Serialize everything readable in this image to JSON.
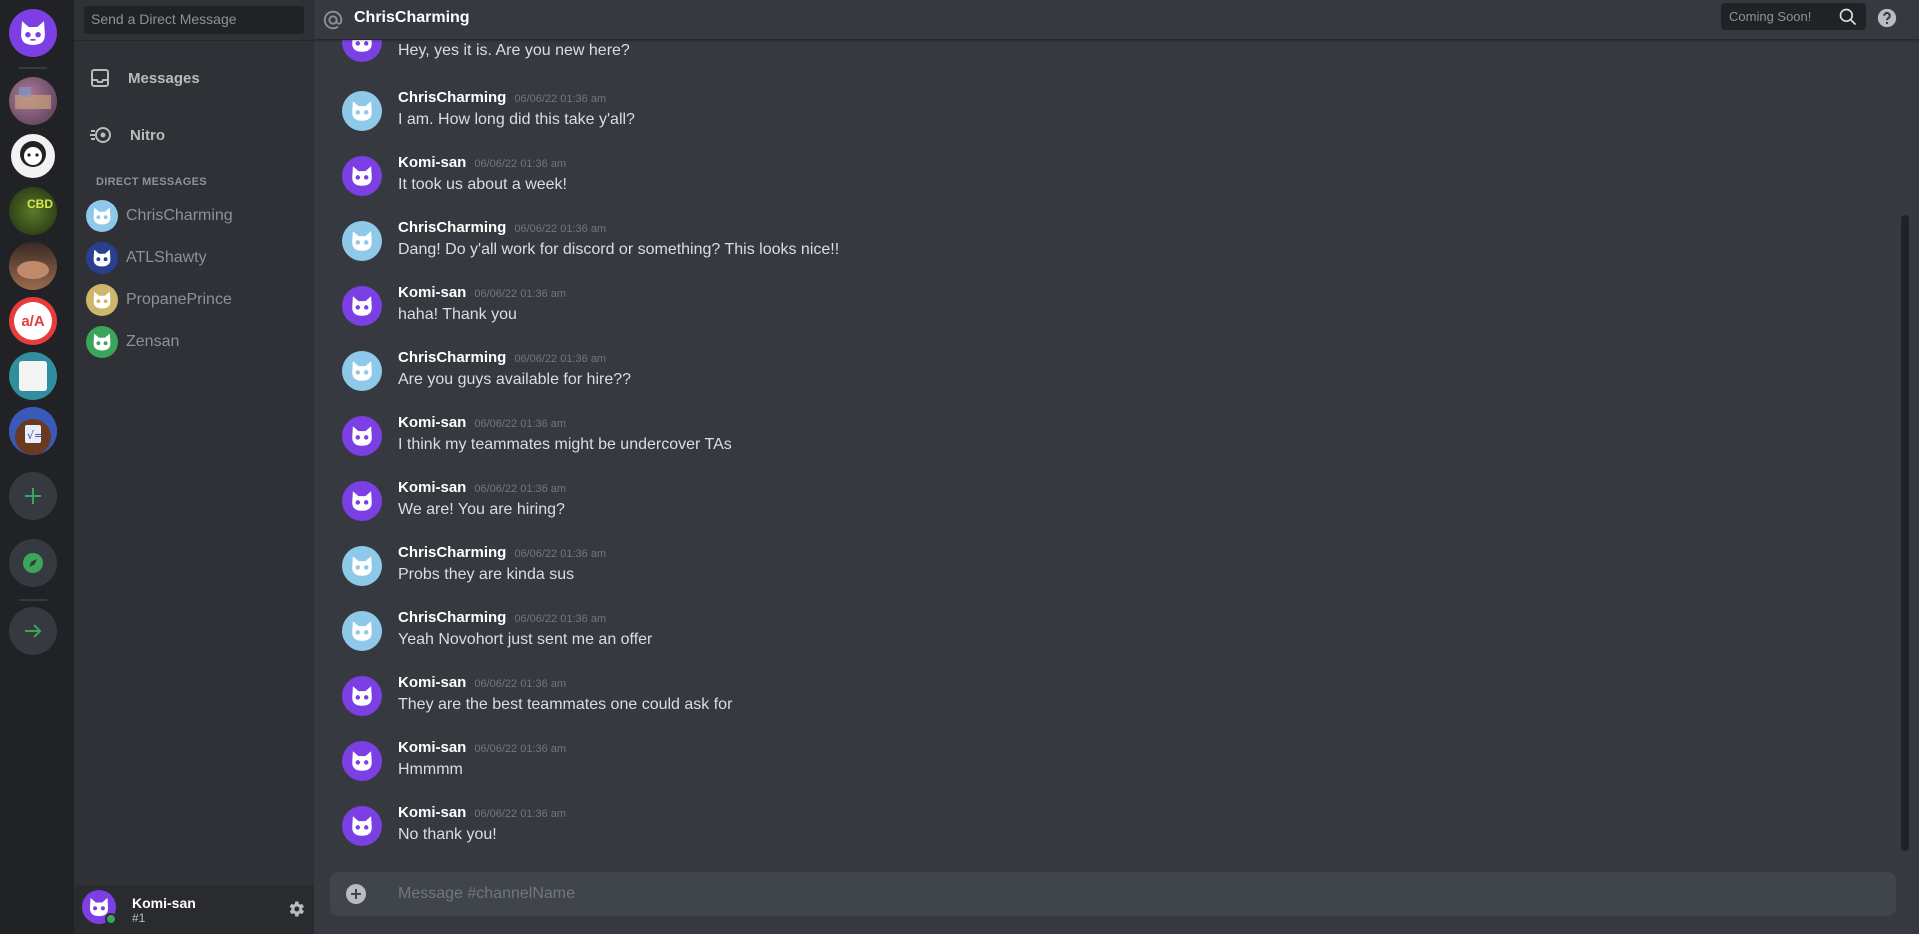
{
  "servers": [
    {
      "name": "home",
      "color": "#7b3fe4",
      "icon": "cat-logo-icon"
    },
    {
      "name": "server-1",
      "color": "#6b5b6e",
      "icon": "server-image-1"
    },
    {
      "name": "server-2",
      "color": "#eeeeee",
      "icon": "server-image-2"
    },
    {
      "name": "server-3",
      "color": "#3d5a1e",
      "icon": "server-image-3",
      "label": "CBD"
    },
    {
      "name": "server-4",
      "color": "#7a5a4a",
      "icon": "server-image-4"
    },
    {
      "name": "server-5",
      "color": "#e83c3c",
      "icon": "server-image-5",
      "label": "a/A"
    },
    {
      "name": "server-6",
      "color": "#2f8f9f",
      "icon": "server-image-6"
    },
    {
      "name": "server-7",
      "color": "#2a4aa8",
      "icon": "server-image-7"
    }
  ],
  "sidebar": {
    "search_placeholder": "Send a Direct Message",
    "nav": [
      {
        "label": "Messages",
        "icon": "inbox-icon"
      },
      {
        "label": "Nitro",
        "icon": "nitro-icon"
      }
    ],
    "dm_header": "DIRECT MESSAGES",
    "dms": [
      {
        "name": "ChrisCharming",
        "color": "#8fc9ea"
      },
      {
        "name": "ATLShawty",
        "color": "#2a3f8f"
      },
      {
        "name": "PropanePrince",
        "color": "#cdb76a"
      },
      {
        "name": "Zensan",
        "color": "#3ba55c"
      }
    ]
  },
  "user": {
    "name": "Komi-san",
    "tag": "#1"
  },
  "header": {
    "channel": "ChrisCharming",
    "search_placeholder": "Coming Soon!"
  },
  "messages": [
    {
      "author": "",
      "time": "",
      "text": "Hey, yes it is. Are you new here?",
      "color": "#7b3fe4"
    },
    {
      "author": "ChrisCharming",
      "time": "06/06/22 01:36 am",
      "text": "I am. How long did this take y'all?",
      "color": "#8fc9ea"
    },
    {
      "author": "Komi-san",
      "time": "06/06/22 01:36 am",
      "text": "It took us about a week!",
      "color": "#7b3fe4"
    },
    {
      "author": "ChrisCharming",
      "time": "06/06/22 01:36 am",
      "text": "Dang! Do y'all work for discord or something? This looks nice!!",
      "color": "#8fc9ea"
    },
    {
      "author": "Komi-san",
      "time": "06/06/22 01:36 am",
      "text": "haha! Thank you",
      "color": "#7b3fe4"
    },
    {
      "author": "ChrisCharming",
      "time": "06/06/22 01:36 am",
      "text": "Are you guys available for hire??",
      "color": "#8fc9ea"
    },
    {
      "author": "Komi-san",
      "time": "06/06/22 01:36 am",
      "text": "I think my teammates might be undercover TAs",
      "color": "#7b3fe4"
    },
    {
      "author": "Komi-san",
      "time": "06/06/22 01:36 am",
      "text": "We are! You are hiring?",
      "color": "#7b3fe4"
    },
    {
      "author": "ChrisCharming",
      "time": "06/06/22 01:36 am",
      "text": "Probs they are kinda sus",
      "color": "#8fc9ea"
    },
    {
      "author": "ChrisCharming",
      "time": "06/06/22 01:36 am",
      "text": "Yeah Novohort just sent me an offer",
      "color": "#8fc9ea"
    },
    {
      "author": "Komi-san",
      "time": "06/06/22 01:36 am",
      "text": "They are the best teammates one could ask for",
      "color": "#7b3fe4"
    },
    {
      "author": "Komi-san",
      "time": "06/06/22 01:36 am",
      "text": "Hmmmm",
      "color": "#7b3fe4"
    },
    {
      "author": "Komi-san",
      "time": "06/06/22 01:36 am",
      "text": "No thank you!",
      "color": "#7b3fe4"
    }
  ],
  "composer": {
    "placeholder": "Message #channelName"
  }
}
